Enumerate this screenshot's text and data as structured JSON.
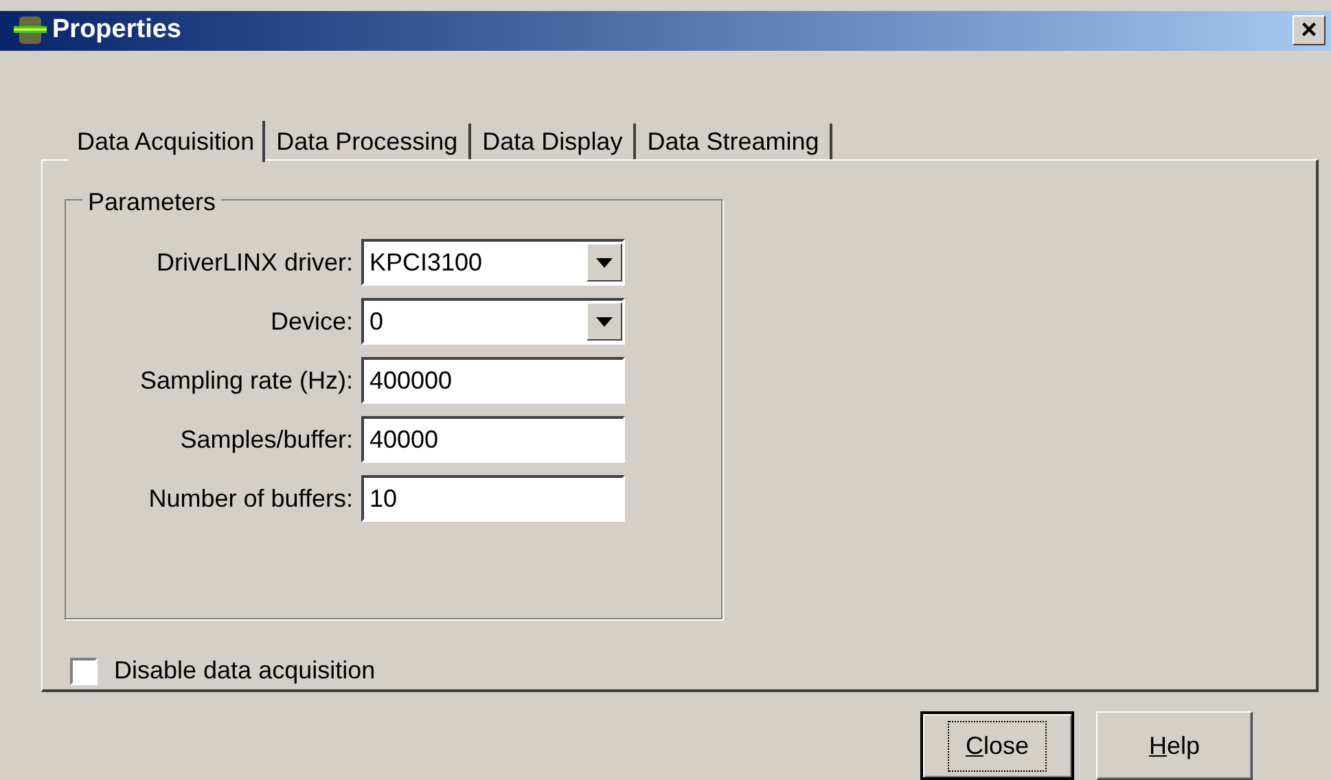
{
  "window": {
    "title": "Properties",
    "close": "×"
  },
  "tabs": [
    {
      "label": "Data Acquisition",
      "selected": true
    },
    {
      "label": "Data Processing",
      "selected": false
    },
    {
      "label": "Data Display",
      "selected": false
    },
    {
      "label": "Data Streaming",
      "selected": false
    }
  ],
  "group": {
    "title": "Parameters",
    "fields": [
      {
        "kind": "dropdown",
        "label": "DriverLINX driver:",
        "value": "KPCI3100"
      },
      {
        "kind": "dropdown",
        "label": "Device:",
        "value": "0"
      },
      {
        "kind": "text",
        "label": "Sampling rate (Hz):",
        "value": "400000"
      },
      {
        "kind": "text",
        "label": "Samples/buffer:",
        "value": "40000"
      },
      {
        "kind": "text",
        "label": "Number of buffers:",
        "value": "10"
      }
    ]
  },
  "checkbox": {
    "label": "Disable data acquisition",
    "checked": false
  },
  "buttons": [
    {
      "mnemonic": "C",
      "rest": "lose",
      "focused": true
    },
    {
      "mnemonic": "H",
      "rest": "elp",
      "focused": false
    }
  ]
}
